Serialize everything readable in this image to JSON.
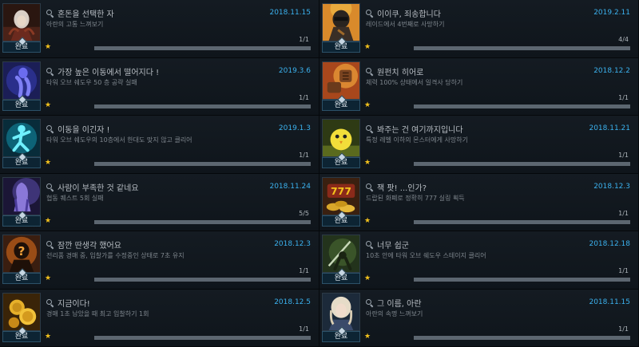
{
  "status_label": "완료",
  "achievements": [
    {
      "title": "혼돈을 선택한 자",
      "description": "아란의 고통 느껴보기",
      "date": "2018.11.15",
      "count": "1/1",
      "progress": 1.0
    },
    {
      "title": "이이쿠, 죄송합니다",
      "description": "레이드에서 4번째로 사망하기",
      "date": "2019.2.11",
      "count": "4/4",
      "progress": 1.0
    },
    {
      "title": "가장 높은 이동에서 떨어지다 !",
      "description": "타워 오브 쉐도우 50 층 공략 실패",
      "date": "2019.3.6",
      "count": "1/1",
      "progress": 1.0
    },
    {
      "title": "원펀치 히어로",
      "description": "체력 100% 상태에서 일격사 당하기",
      "date": "2018.12.2",
      "count": "1/1",
      "progress": 1.0
    },
    {
      "title": "이동을 이긴자 !",
      "description": "타워 오브 쉐도우의 10층에서 한대도 맞지 않고 클리어",
      "date": "2019.1.3",
      "count": "1/1",
      "progress": 1.0
    },
    {
      "title": "봐주는 건 여기까지입니다",
      "description": "특정 레벨 이하의 몬스터에게 사망하기",
      "date": "2018.11.21",
      "count": "1/1",
      "progress": 1.0
    },
    {
      "title": "사람이 부족한 것 같네요",
      "description": "협동 퀘스트 5회 실패",
      "date": "2018.11.24",
      "count": "5/5",
      "progress": 1.0
    },
    {
      "title": "잭 팟! ...인가?",
      "description": "드랍된 화폐로 정확히 777 실링 획득",
      "date": "2018.12.3",
      "count": "1/1",
      "progress": 1.0
    },
    {
      "title": "잠깐 딴생각 했어요",
      "description": "전리품 경매 중, 입찰가를 수정중인 상태로 7초 유지",
      "date": "2018.12.3",
      "count": "1/1",
      "progress": 1.0
    },
    {
      "title": "너무 쉽군",
      "description": "10초 안에 타워 오브 쉐도우 스테이지 클리어",
      "date": "2018.12.18",
      "count": "1/1",
      "progress": 1.0
    },
    {
      "title": "지금이다!",
      "description": "경매 1초 남았을 때 최고 입찰하기 1회",
      "date": "2018.12.5",
      "count": "1/1",
      "progress": 1.0
    },
    {
      "title": "그 이름, 아란",
      "description": "아란의 속명 느껴보기",
      "date": "2018.11.15",
      "count": "1/1",
      "progress": 1.0
    }
  ],
  "colors": {
    "date": "#3bb1ee",
    "star": "#f4c21c",
    "badge_bg": "#0d2433"
  }
}
